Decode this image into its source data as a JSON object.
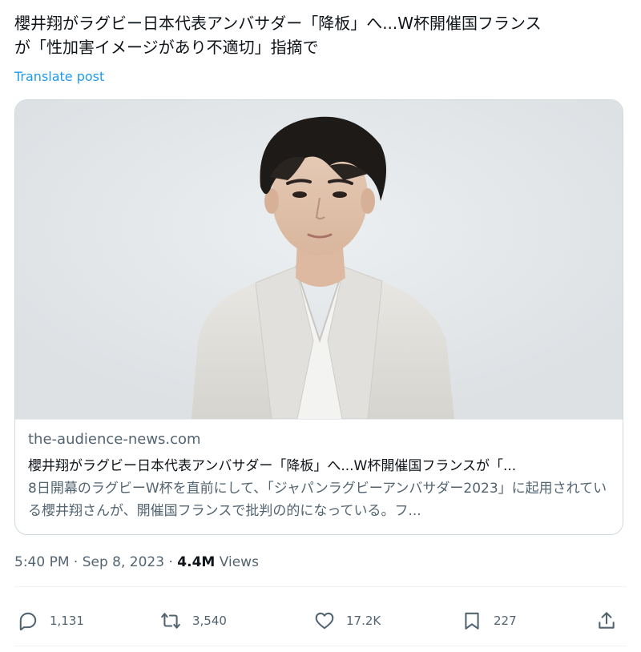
{
  "tweet": {
    "text_line1": "櫻井翔がラグビー日本代表アンバサダー「降板」へ...W杯開催国フランス",
    "text_line2": "が「性加害イメージがあり不適切」指摘で",
    "translate_label": "Translate post"
  },
  "card": {
    "domain": "the-audience-news.com",
    "title": "櫻井翔がラグビー日本代表アンバサダー「降板」へ...W杯開催国フランスが「...",
    "description": "8日開幕のラグビーW杯を直前にして、「ジャパンラグビーアンバサダー2023」に起用されている櫻井翔さんが、開催国フランスで批判の的になっている。フ..."
  },
  "meta": {
    "time": "5:40 PM",
    "dot1": " · ",
    "date": "Sep 8, 2023",
    "dot2": " · ",
    "views_count": "4.4M",
    "views_label": " Views"
  },
  "actions": {
    "reply": {
      "icon": "reply-icon",
      "count": "1,131"
    },
    "repost": {
      "icon": "repost-icon",
      "count": "3,540"
    },
    "like": {
      "icon": "like-icon",
      "count": "17.2K"
    },
    "bookmark": {
      "icon": "bookmark-icon",
      "count": "227"
    },
    "share": {
      "icon": "share-icon"
    }
  },
  "colors": {
    "accent": "#1d9bf0",
    "text_primary": "#0f1419",
    "text_secondary": "#536471",
    "border": "#cfd9de"
  }
}
